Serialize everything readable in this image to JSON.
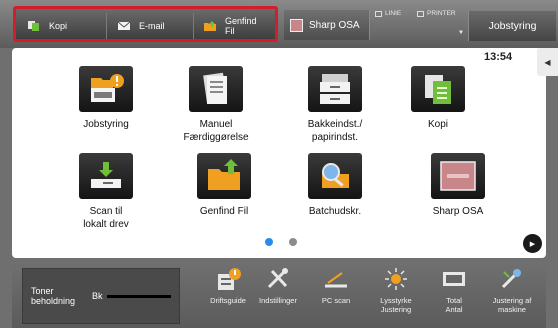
{
  "topbar": {
    "shortcuts": [
      {
        "icon": "copy-icon",
        "label": "Kopi"
      },
      {
        "icon": "email-icon",
        "label": "E-mail"
      },
      {
        "icon": "folder-retrieve-icon",
        "label": "Genfind\nFil"
      }
    ],
    "osa_label": "Sharp OSA",
    "indicator_line": "LINIE",
    "indicator_printer": "PRINTER",
    "job_button": "Jobstyring"
  },
  "clock": "13:54",
  "apps": [
    {
      "icon": "job-status-icon",
      "label": "Jobstyring"
    },
    {
      "icon": "manual-finishing-icon",
      "label": "Manuel\nFærdiggørelse"
    },
    {
      "icon": "tray-settings-icon",
      "label": "Bakkeindst./\npapirindst."
    },
    {
      "icon": "copy-icon",
      "label": "Kopi"
    },
    {
      "icon": "scan-to-drive-icon",
      "label": "Scan til\nlokalt drev"
    },
    {
      "icon": "folder-retrieve-icon",
      "label": "Genfind Fil"
    },
    {
      "icon": "batch-print-icon",
      "label": "Batchudskr."
    },
    {
      "icon": "sharp-osa-icon",
      "label": "Sharp OSA"
    }
  ],
  "pager": {
    "current": 1,
    "total": 2
  },
  "toner": {
    "label": "Toner\nbeholdning",
    "color": "Bk"
  },
  "tools": [
    {
      "icon": "operation-guide-icon",
      "label": "Driftsguide"
    },
    {
      "icon": "settings-icon",
      "label": "Indstillinger"
    },
    {
      "icon": "pc-scan-icon",
      "label": "PC scan"
    },
    {
      "icon": "brightness-icon",
      "label": "Lysstyrke\nJustering"
    },
    {
      "icon": "total-count-icon",
      "label": "Total\nAntal"
    },
    {
      "icon": "machine-adjust-icon",
      "label": "Justering af\nmaskine"
    }
  ],
  "colors": {
    "highlight": "#d01f2a",
    "pager_active": "#2a8ce6",
    "accent_orange": "#f0a020",
    "accent_green": "#6fbf3a"
  }
}
